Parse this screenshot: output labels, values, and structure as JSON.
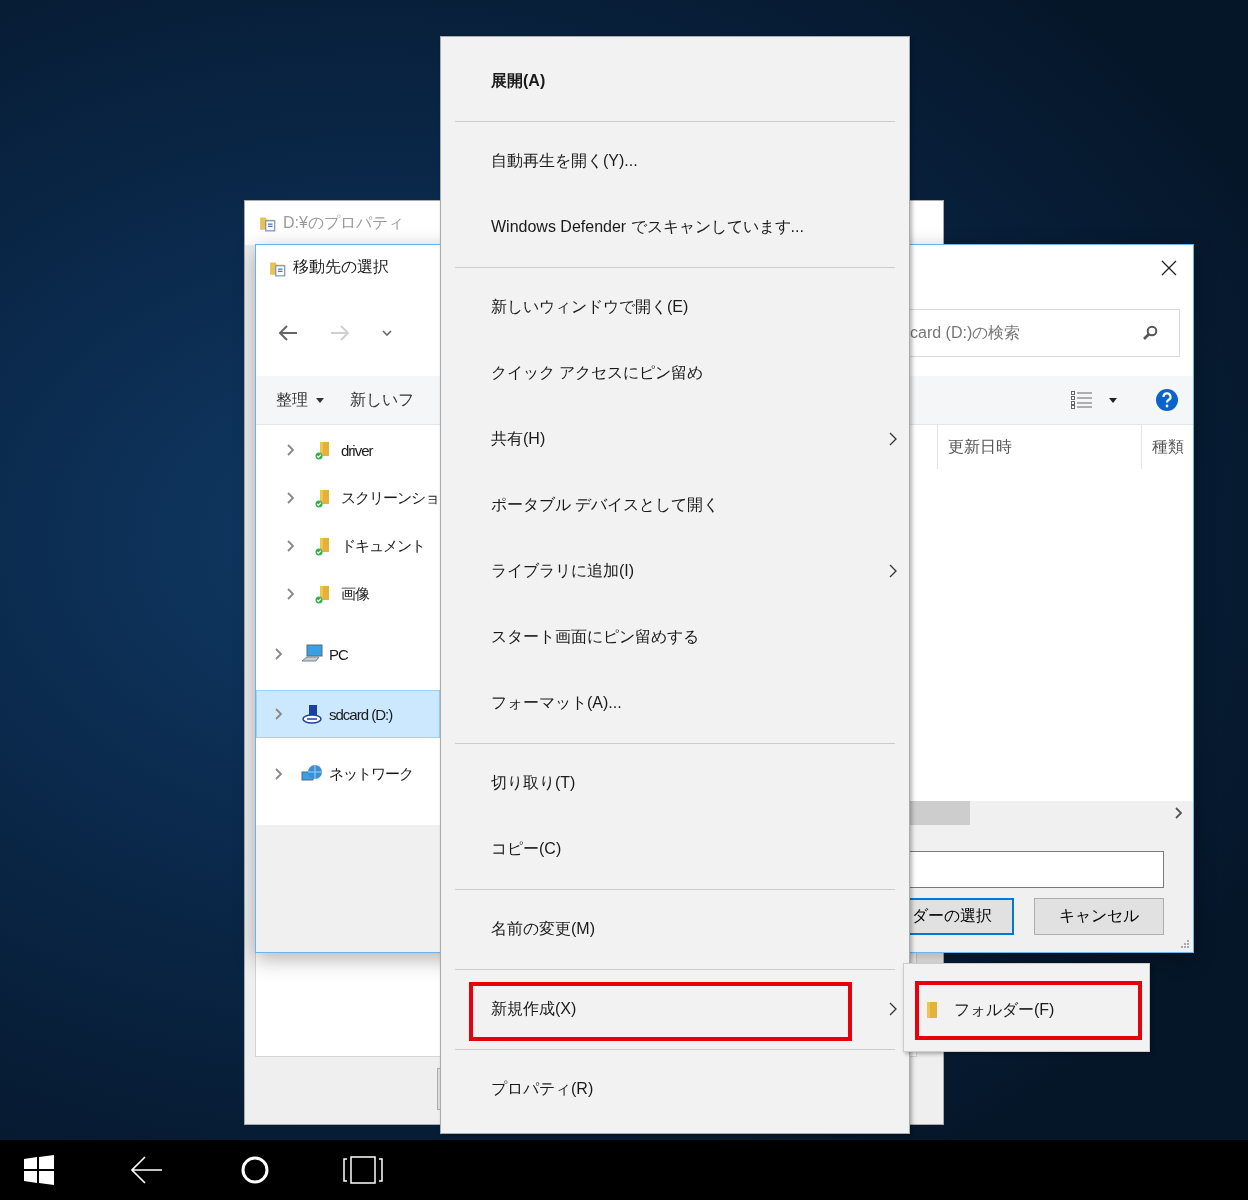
{
  "background_window": {
    "title": "D:¥のプロパティ"
  },
  "dialog": {
    "title": "移動先の選択",
    "toolbar": [
      {
        "label": "整理",
        "dropdown": true
      },
      {
        "label": "新しいフ",
        "dropdown": false
      }
    ],
    "tree": [
      {
        "kind": "folder",
        "label": "driver",
        "selected": false
      },
      {
        "kind": "folder",
        "label": "スクリーンショ",
        "selected": false
      },
      {
        "kind": "folder",
        "label": "ドキュメント",
        "selected": false
      },
      {
        "kind": "folder",
        "label": "画像",
        "selected": false
      },
      {
        "kind": "pc",
        "label": "PC",
        "selected": false
      },
      {
        "kind": "drive",
        "label": "sdcard (D:)",
        "selected": true
      },
      {
        "kind": "network",
        "label": "ネットワーク",
        "selected": false
      }
    ],
    "search": {
      "placeholder": "card (D:)の検索"
    },
    "columns": [
      "更新日時",
      "種類"
    ],
    "buttons": [
      {
        "label": "ダーの選択",
        "default": true
      },
      {
        "label": "キャンセル",
        "default": false
      }
    ]
  },
  "context_menu": {
    "items": [
      {
        "kind": "item",
        "label": "展開(A)",
        "bold": true,
        "submenu": false,
        "highlighted": false
      },
      {
        "kind": "separator"
      },
      {
        "kind": "item",
        "label": "自動再生を開く(Y)...",
        "bold": false,
        "submenu": false,
        "highlighted": false
      },
      {
        "kind": "item",
        "label": "Windows Defender でスキャンしています...",
        "bold": false,
        "submenu": false,
        "highlighted": false
      },
      {
        "kind": "separator"
      },
      {
        "kind": "item",
        "label": "新しいウィンドウで開く(E)",
        "bold": false,
        "submenu": false,
        "highlighted": false
      },
      {
        "kind": "item",
        "label": "クイック アクセスにピン留め",
        "bold": false,
        "submenu": false,
        "highlighted": false
      },
      {
        "kind": "item",
        "label": "共有(H)",
        "bold": false,
        "submenu": true,
        "highlighted": false
      },
      {
        "kind": "item",
        "label": "ポータブル デバイスとして開く",
        "bold": false,
        "submenu": false,
        "highlighted": false
      },
      {
        "kind": "item",
        "label": "ライブラリに追加(I)",
        "bold": false,
        "submenu": true,
        "highlighted": false
      },
      {
        "kind": "item",
        "label": "スタート画面にピン留めする",
        "bold": false,
        "submenu": false,
        "highlighted": false
      },
      {
        "kind": "item",
        "label": "フォーマット(A)...",
        "bold": false,
        "submenu": false,
        "highlighted": false
      },
      {
        "kind": "separator"
      },
      {
        "kind": "item",
        "label": "切り取り(T)",
        "bold": false,
        "submenu": false,
        "highlighted": false
      },
      {
        "kind": "item",
        "label": "コピー(C)",
        "bold": false,
        "submenu": false,
        "highlighted": false
      },
      {
        "kind": "separator"
      },
      {
        "kind": "item",
        "label": "名前の変更(M)",
        "bold": false,
        "submenu": false,
        "highlighted": false
      },
      {
        "kind": "separator"
      },
      {
        "kind": "item",
        "label": "新規作成(X)",
        "bold": false,
        "submenu": true,
        "highlighted": true
      },
      {
        "kind": "separator"
      },
      {
        "kind": "item",
        "label": "プロパティ(R)",
        "bold": false,
        "submenu": false,
        "highlighted": false
      }
    ]
  },
  "submenu": {
    "items": [
      {
        "label": "フォルダー(F)",
        "highlighted": true
      }
    ]
  }
}
